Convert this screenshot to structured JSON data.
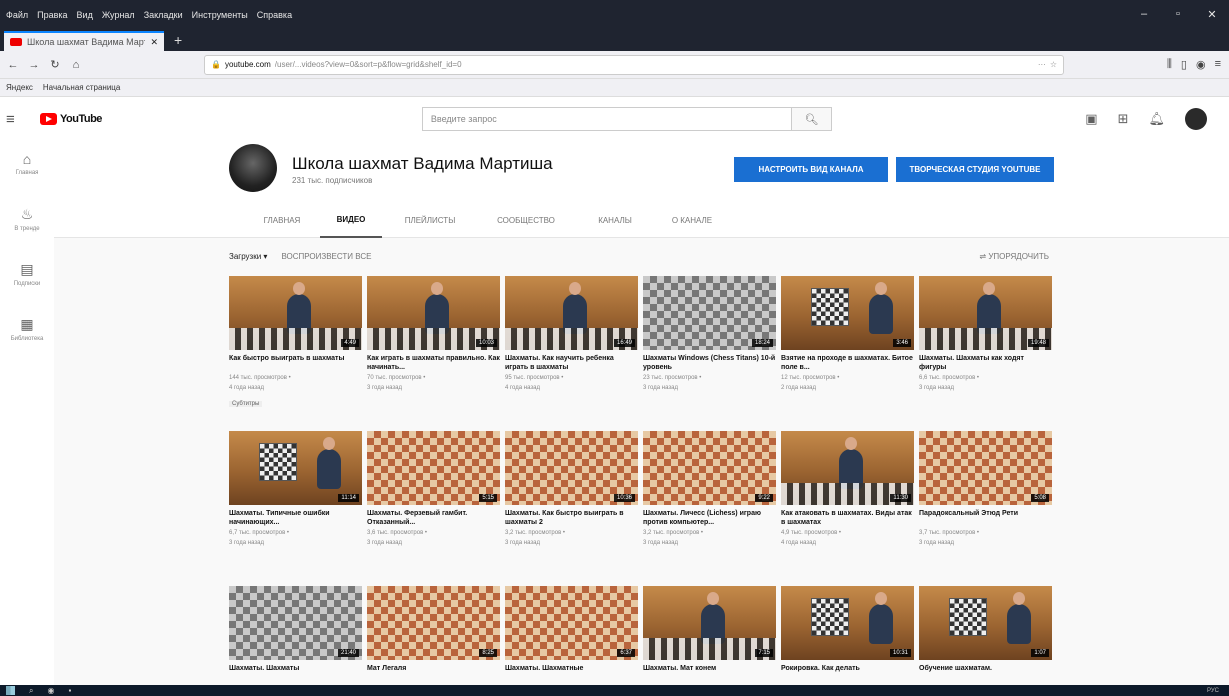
{
  "browser": {
    "menu": [
      "Файл",
      "Правка",
      "Вид",
      "Журнал",
      "Закладки",
      "Инструменты",
      "Справка"
    ],
    "tab_title": "Школа шахмат Вадима Март",
    "url_domain": "youtube.com",
    "url_rest": "/user/...videos?view=0&sort=p&flow=grid&shelf_id=0",
    "bookmarks": [
      "Яндекс",
      "Начальная страница"
    ]
  },
  "youtube": {
    "logo_text": "YouTube",
    "search_placeholder": "Введите запрос",
    "guide": [
      {
        "icon": "home-icon",
        "label": "Главная"
      },
      {
        "icon": "fire-icon",
        "label": "В тренде"
      },
      {
        "icon": "subscriptions-icon",
        "label": "Подписки"
      },
      {
        "icon": "library-icon",
        "label": "Библиотека"
      }
    ]
  },
  "channel": {
    "name": "Школа шахмат Вадима Мартиша",
    "subs": "231 тыс. подписчиков",
    "btn_customize": "НАСТРОИТЬ ВИД КАНАЛА",
    "btn_studio": "ТВОРЧЕСКАЯ СТУДИЯ YOUTUBE",
    "tabs": [
      "ГЛАВНАЯ",
      "ВИДЕО",
      "ПЛЕЙЛИСТЫ",
      "СООБЩЕСТВО",
      "КАНАЛЫ",
      "О КАНАЛЕ"
    ],
    "active_tab": 1
  },
  "videos_toolbar": {
    "uploads": "Загрузки ▾",
    "play_all": "ВОСПРОИЗВЕСТИ ВСЕ",
    "sort": "УПОРЯДОЧИТЬ"
  },
  "videos": [
    {
      "title": "Как быстро выиграть в шахматы",
      "views": "144 тыс. просмотров •",
      "age": "4 года назад",
      "dur": "4:49",
      "kind": "wood",
      "cc": "Субтитры"
    },
    {
      "title": "Как играть в шахматы правильно. Как начинать...",
      "views": "70 тыс. просмотров •",
      "age": "3 года назад",
      "dur": "10:03",
      "kind": "wood"
    },
    {
      "title": "Шахматы. Как научить ребенка играть в шахматы",
      "views": "95 тыс. просмотров •",
      "age": "4 года назад",
      "dur": "16:49",
      "kind": "wood"
    },
    {
      "title": "Шахматы Windows (Chess Titans) 10-й уровень",
      "views": "23 тыс. просмотров •",
      "age": "3 года назад",
      "dur": "18:24",
      "kind": "gray"
    },
    {
      "title": "Взятие на проходе в шахматах. Битое поле в...",
      "views": "12 тыс. просмотров •",
      "age": "2 года назад",
      "dur": "3:46",
      "kind": "wood2"
    },
    {
      "title": "Шахматы. Шахматы как ходят фигуры",
      "views": "6,6 тыс. просмотров •",
      "age": "3 года назад",
      "dur": "19:48",
      "kind": "wood"
    },
    {
      "title": "Шахматы. Типичные ошибки начинающих...",
      "views": "6,7 тыс. просмотров •",
      "age": "3 года назад",
      "dur": "11:14",
      "kind": "wood2"
    },
    {
      "title": "Шахматы. Ферзевый гамбит. Отказанный...",
      "views": "3,6 тыс. просмотров •",
      "age": "3 года назад",
      "dur": "5:15",
      "kind": "board"
    },
    {
      "title": "Шахматы. Как быстро выиграть в шахматы 2",
      "views": "3,2 тыс. просмотров •",
      "age": "3 года назад",
      "dur": "10:36",
      "kind": "board"
    },
    {
      "title": "Шахматы. Личесс (Lichess) играю против компьютер...",
      "views": "3,2 тыс. просмотров •",
      "age": "3 года назад",
      "dur": "9:22",
      "kind": "boardlight"
    },
    {
      "title": "Как атаковать в шахматах. Виды атак в шахматах",
      "views": "4,9 тыс. просмотров •",
      "age": "4 года назад",
      "dur": "11:30",
      "kind": "wood"
    },
    {
      "title": "Парадоксальный Этюд Рети",
      "views": "3,7 тыс. просмотров •",
      "age": "3 года назад",
      "dur": "5:08",
      "kind": "board"
    },
    {
      "title": "Шахматы. Шахматы",
      "views": "",
      "age": "",
      "dur": "21:40",
      "kind": "gray"
    },
    {
      "title": "Мат Легаля",
      "views": "",
      "age": "",
      "dur": "8:25",
      "kind": "board"
    },
    {
      "title": "Шахматы. Шахматные",
      "views": "",
      "age": "",
      "dur": "6:37",
      "kind": "board"
    },
    {
      "title": "Шахматы. Мат конем",
      "views": "",
      "age": "",
      "dur": "7:15",
      "kind": "wood"
    },
    {
      "title": "Рокировка. Как делать",
      "views": "",
      "age": "",
      "dur": "10:31",
      "kind": "wood2"
    },
    {
      "title": "Обучение шахматам.",
      "views": "",
      "age": "",
      "dur": "1:07",
      "kind": "wood2"
    }
  ],
  "taskbar": {
    "tray": "РУС"
  }
}
